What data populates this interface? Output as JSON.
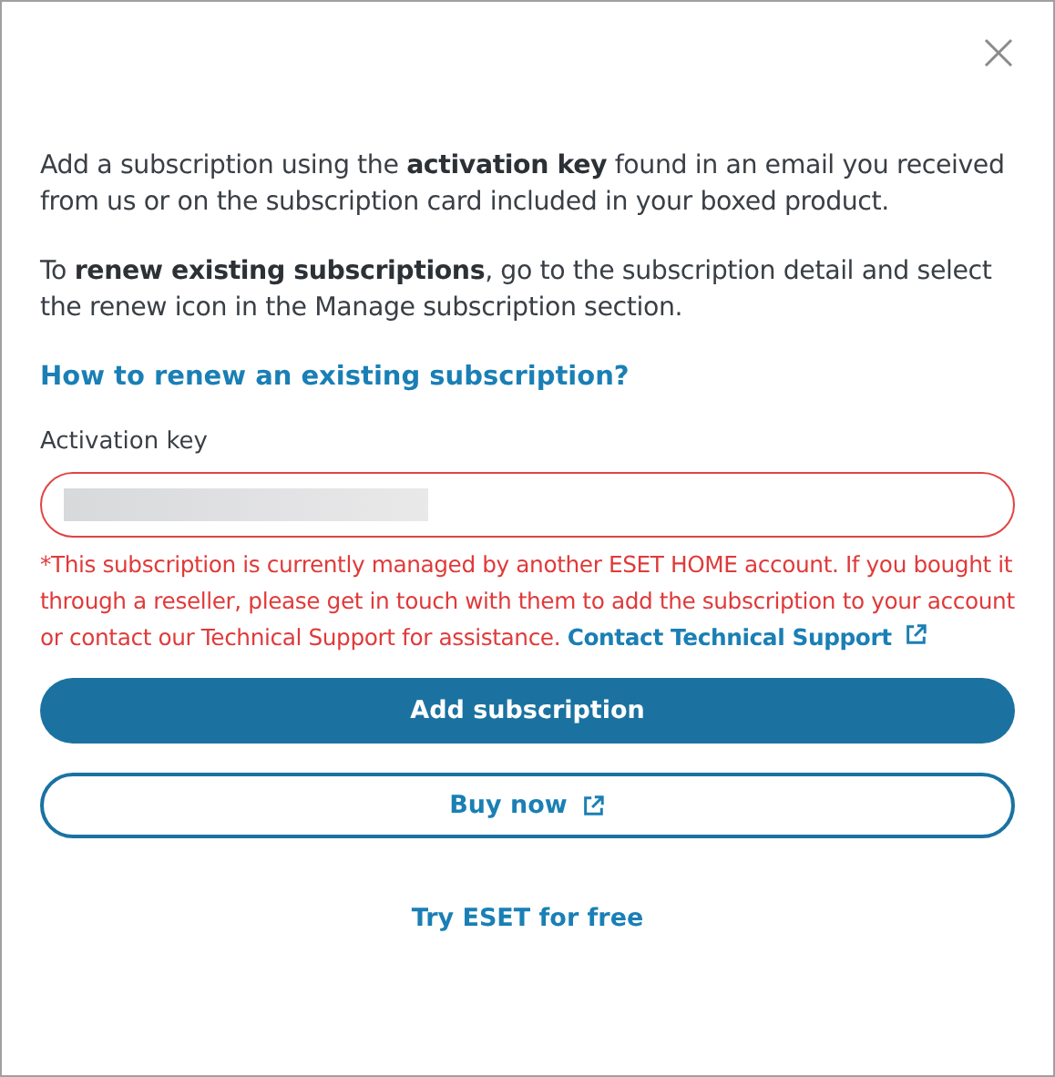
{
  "dialog": {
    "paragraphs": [
      "Add a subscription using the **activation key** found in an email you received from us or on the subscription card included in your boxed product.",
      "To **renew existing subscriptions**, go to the subscription detail and select the renew icon in the Manage subscription section."
    ],
    "help_link": "How to renew an existing subscription?",
    "field": {
      "label": "Activation key",
      "error": true,
      "value_redacted": true
    },
    "error_message": "*This subscription is currently managed by another ESET HOME account. If you bought it through a reseller, please get in touch with them to add the subscription to your account or contact our Technical Support for assistance.",
    "error_link": "Contact Technical Support",
    "buttons": [
      {
        "label": "Add subscription",
        "kind": "primary"
      },
      {
        "label": "Buy now",
        "kind": "outline"
      },
      {
        "label": "Try ESET for free",
        "kind": "text"
      }
    ]
  }
}
